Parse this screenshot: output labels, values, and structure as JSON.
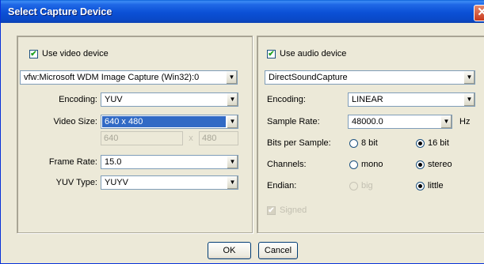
{
  "window": {
    "title": "Select Capture Device",
    "close_glyph": "✕"
  },
  "video": {
    "use_label": "Use video device",
    "use_checked": true,
    "device": "vfw:Microsoft WDM Image Capture (Win32):0",
    "encoding_label": "Encoding:",
    "encoding": "YUV",
    "size_label": "Video Size:",
    "size": "640 x 480",
    "width": "640",
    "separator": "x",
    "height": "480",
    "framerate_label": "Frame Rate:",
    "framerate": "15.0",
    "yuvtype_label": "YUV Type:",
    "yuvtype": "YUYV"
  },
  "audio": {
    "use_label": "Use audio device",
    "use_checked": true,
    "device": "DirectSoundCapture",
    "encoding_label": "Encoding:",
    "encoding": "LINEAR",
    "rate_label": "Sample Rate:",
    "rate": "48000.0",
    "rate_unit": "Hz",
    "bits_label": "Bits per Sample:",
    "bits_8": "8 bit",
    "bits_16": "16 bit",
    "bits_selected": "16 bit",
    "channels_label": "Channels:",
    "channels_mono": "mono",
    "channels_stereo": "stereo",
    "channels_selected": "stereo",
    "endian_label": "Endian:",
    "endian_big": "big",
    "endian_little": "little",
    "endian_selected": "little",
    "signed_label": "Signed"
  },
  "buttons": {
    "ok": "OK",
    "cancel": "Cancel"
  },
  "icons": {
    "check": "✔",
    "dropdown": "▼"
  }
}
